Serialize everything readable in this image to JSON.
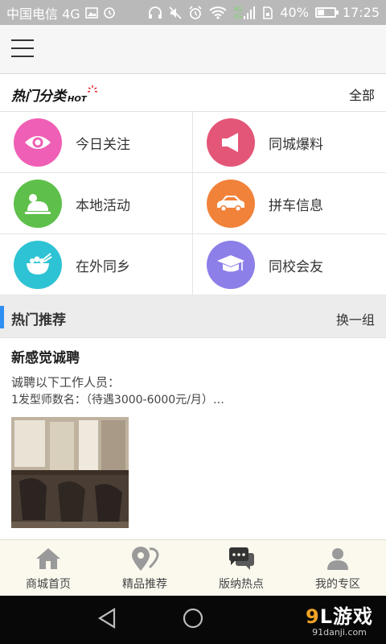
{
  "status_bar": {
    "carrier": "中国电信 4G",
    "battery": "40%",
    "battery_level": 0.4,
    "time": "17:25",
    "icons": [
      "image-icon",
      "sync-icon",
      "headphones-icon",
      "mute-icon",
      "alarm-icon",
      "wifi-icon",
      "signal-icon",
      "sim-icon",
      "battery-icon"
    ]
  },
  "header": {
    "menu_icon": "hamburger-menu-icon"
  },
  "hot_category": {
    "logo_text": "热门分类",
    "logo_badge": "HOT",
    "all_label": "全部",
    "items": [
      {
        "label": "今日关注",
        "icon": "eye-icon",
        "color": "#ef5fb5"
      },
      {
        "label": "同城爆料",
        "icon": "megaphone-icon",
        "color": "#e35677"
      },
      {
        "label": "本地活动",
        "icon": "event-icon",
        "color": "#5ec04a"
      },
      {
        "label": "拼车信息",
        "icon": "car-icon",
        "color": "#f1823a"
      },
      {
        "label": "在外同乡",
        "icon": "bowl-icon",
        "color": "#2ec3d4"
      },
      {
        "label": "同校会友",
        "icon": "graduation-cap-icon",
        "color": "#8c7fe8"
      }
    ]
  },
  "recommend": {
    "title": "热门推荐",
    "switch_label": "换一组",
    "accent_color": "#2e8ff2"
  },
  "post": {
    "title": "新感觉诚聘",
    "line1": "诚聘以下工作人员：",
    "line2": "1发型师数名：（待遇3000-6000元/月）…"
  },
  "tabs": [
    {
      "label": "商城首页",
      "icon": "home-icon"
    },
    {
      "label": "精品推荐",
      "icon": "map-pin-icon"
    },
    {
      "label": "版纳热点",
      "icon": "chat-icon"
    },
    {
      "label": "我的专区",
      "icon": "user-icon"
    }
  ],
  "nav_bar": {
    "icons": [
      "back-icon",
      "home-circle-icon"
    ]
  },
  "watermark": {
    "brand_l": "9",
    "brand_r": "L游戏",
    "domain": "91danji.com"
  }
}
